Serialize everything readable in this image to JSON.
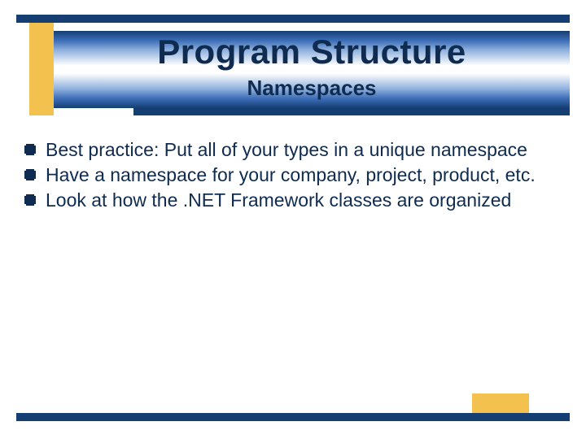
{
  "header": {
    "title": "Program Structure",
    "subtitle": "Namespaces"
  },
  "bullets": [
    "Best practice: Put all of your types in a unique namespace",
    "Have a namespace for your company, project, product, etc.",
    "Look at how the .NET Framework classes are organized"
  ],
  "colors": {
    "navy": "#153e72",
    "gold": "#f2c14e"
  }
}
